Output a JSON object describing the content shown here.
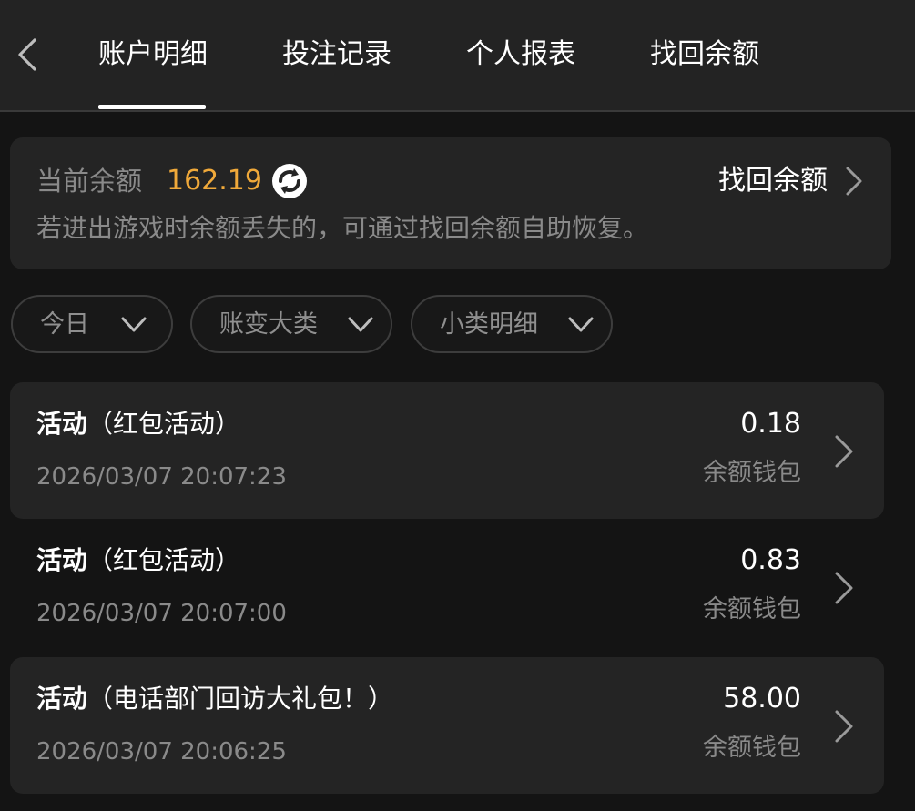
{
  "nav": {
    "tabs": [
      {
        "label": "账户明细",
        "active": true
      },
      {
        "label": "投注记录",
        "active": false
      },
      {
        "label": "个人报表",
        "active": false
      },
      {
        "label": "找回余额",
        "active": false
      }
    ]
  },
  "balance": {
    "label": "当前余额",
    "amount": "162.19",
    "recover_label": "找回余额",
    "hint": "若进出游戏时余额丢失的，可通过找回余额自助恢复。"
  },
  "filters": [
    {
      "label": "今日"
    },
    {
      "label": "账变大类"
    },
    {
      "label": "小类明细"
    }
  ],
  "records": [
    {
      "category": "活动",
      "detail": "（红包活动）",
      "time": "2026/03/07 20:07:23",
      "amount": "0.18",
      "wallet": "余额钱包"
    },
    {
      "category": "活动",
      "detail": "（红包活动）",
      "time": "2026/03/07 20:07:00",
      "amount": "0.83",
      "wallet": "余额钱包"
    },
    {
      "category": "活动",
      "detail": "（电话部门回访大礼包！）",
      "time": "2026/03/07 20:06:25",
      "amount": "58.00",
      "wallet": "余额钱包"
    }
  ],
  "colors": {
    "background": "#141414",
    "card": "#242424",
    "topbar": "#232323",
    "accent_amount": "#f0a93a",
    "muted_text": "#8a8a8a"
  },
  "icons": {
    "back": "chevron-left-icon",
    "refresh": "refresh-icon",
    "row_arrow": "chevron-right-icon",
    "dropdown": "chevron-down-icon"
  }
}
